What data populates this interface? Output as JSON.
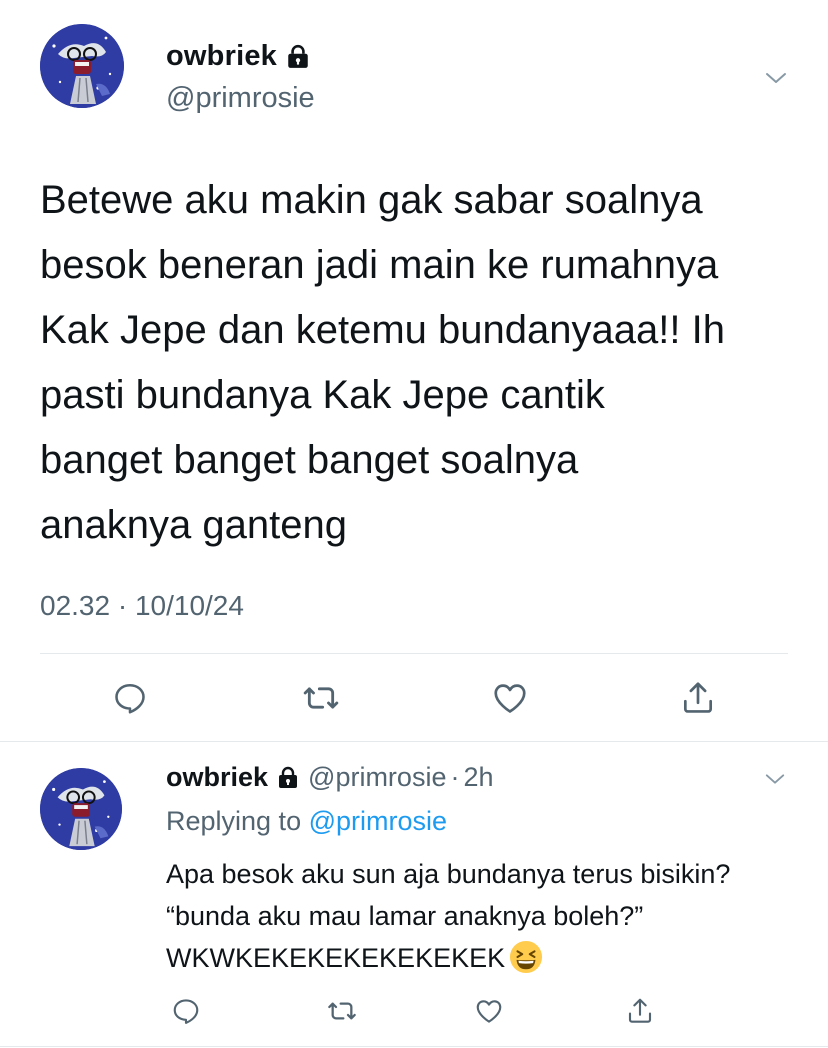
{
  "main_tweet": {
    "display_name": "owbriek",
    "handle": "@primrosie",
    "text": "Betewe aku makin gak sabar soalnya\nbesok beneran jadi main ke rumahnya\nKak Jepe dan ketemu bundanyaaa!! Ih\npasti bundanya Kak Jepe cantik\nbanget banget banget soalnya\nanaknya ganteng",
    "timestamp": "02.32 · 10/10/24",
    "actions": [
      "reply-icon",
      "retweet-icon",
      "like-icon",
      "share-icon"
    ]
  },
  "reply_tweet": {
    "display_name": "owbriek",
    "handle": "@primrosie",
    "separator": "·",
    "time": "2h",
    "replying_prefix": "Replying to",
    "replying_to": "@primrosie",
    "text": "Apa besok aku sun aja bundanya terus bisikin? “bunda aku mau lamar anaknya boleh?” WKWKEKEKEKEKEKEKEK",
    "emoji": "grinning-squinting-face",
    "actions": [
      "reply-icon",
      "retweet-icon",
      "like-icon",
      "share-icon"
    ]
  },
  "colors": {
    "text": "#0f1419",
    "secondary": "#536471",
    "link": "#1d9bf0",
    "divider": "#e6e9ec",
    "avatar_bg": "#2e3a9e"
  }
}
